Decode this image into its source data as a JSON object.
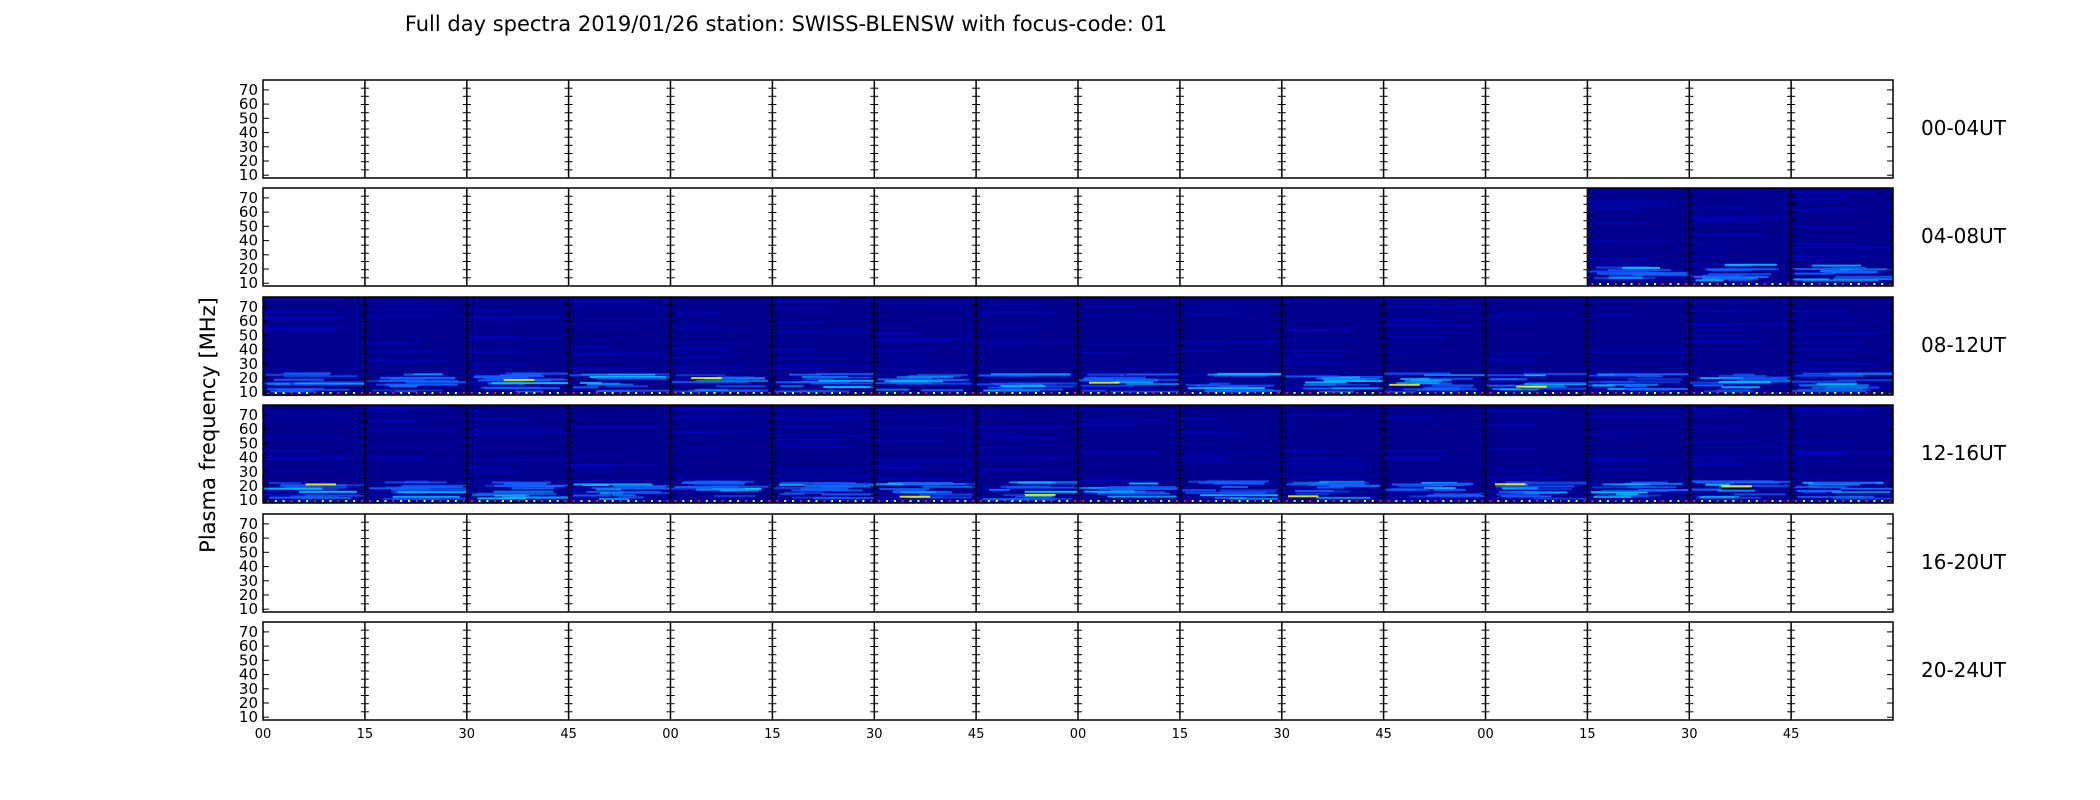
{
  "chart_data": {
    "type": "heatmap",
    "title": "Full day spectra 2019/01/26 station: SWISS-BLENSW with focus-code: 01",
    "ylabel": "Plasma frequency [MHz]",
    "xlabel": "",
    "y_ticks": [
      "10",
      "20",
      "30",
      "40",
      "50",
      "60",
      "70"
    ],
    "ylim": [
      8,
      77
    ],
    "x_ticks": [
      "00",
      "15",
      "30",
      "45",
      "00",
      "15",
      "30",
      "45",
      "00",
      "15",
      "30",
      "45",
      "00",
      "15",
      "30",
      "45"
    ],
    "panels_per_row": 16,
    "minutes_per_panel": 15,
    "rows": [
      {
        "label": "00-04UT",
        "data_panels": []
      },
      {
        "label": "04-08UT",
        "data_panels": [
          13,
          14,
          15
        ]
      },
      {
        "label": "08-12UT",
        "data_panels": [
          0,
          1,
          2,
          3,
          4,
          5,
          6,
          7,
          8,
          9,
          10,
          11,
          12,
          13,
          14,
          15
        ]
      },
      {
        "label": "12-16UT",
        "data_panels": [
          0,
          1,
          2,
          3,
          4,
          5,
          6,
          7,
          8,
          9,
          10,
          11,
          12,
          13,
          14,
          15
        ]
      },
      {
        "label": "16-20UT",
        "data_panels": []
      },
      {
        "label": "20-24UT",
        "data_panels": []
      }
    ],
    "colormap": {
      "low": "#00008f",
      "mid": "#00bfff",
      "high": "#ffff00",
      "peak": "#ff2000"
    },
    "grid": false
  }
}
